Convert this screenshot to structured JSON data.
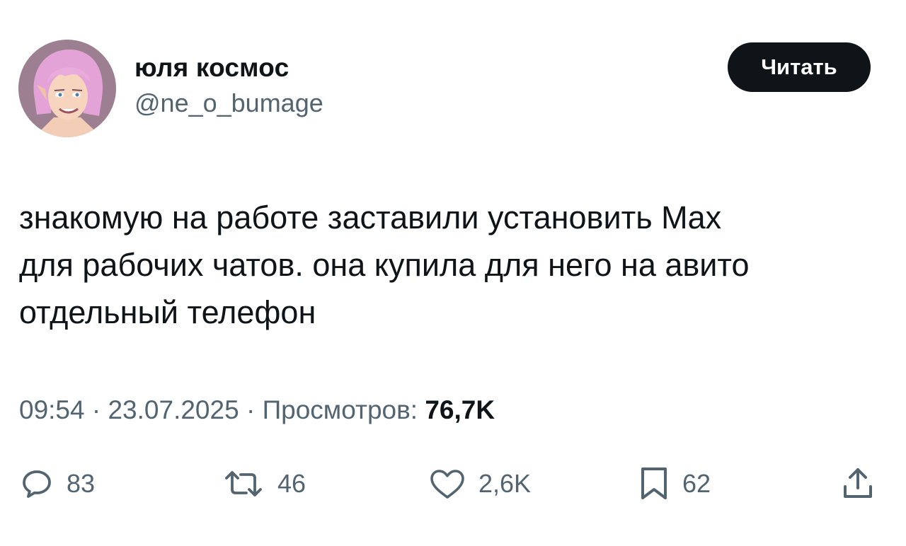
{
  "author": {
    "display_name": "юля космос",
    "handle": "@ne_o_bumage",
    "avatar_icon": "avatar-illustration"
  },
  "follow_button_label": "Читать",
  "tweet": {
    "text_lines": [
      "знакомую на работе заставили установить Max",
      "для рабочих чатов. она купила для него на авито",
      "отдельный телефон"
    ]
  },
  "meta": {
    "time": "09:54",
    "separator": "·",
    "date": "23.07.2025",
    "views_label": "Просмотров:",
    "views_count": "76,7K"
  },
  "actions": {
    "reply": {
      "icon": "reply-icon",
      "count": "83"
    },
    "retweet": {
      "icon": "retweet-icon",
      "count": "46"
    },
    "like": {
      "icon": "heart-icon",
      "count": "2,6K"
    },
    "bookmark": {
      "icon": "bookmark-icon",
      "count": "62"
    },
    "share": {
      "icon": "share-icon"
    }
  },
  "colors": {
    "text_primary": "#0f1419",
    "text_secondary": "#536471",
    "button_bg": "#0f1419",
    "button_text": "#ffffff",
    "background": "#ffffff"
  }
}
